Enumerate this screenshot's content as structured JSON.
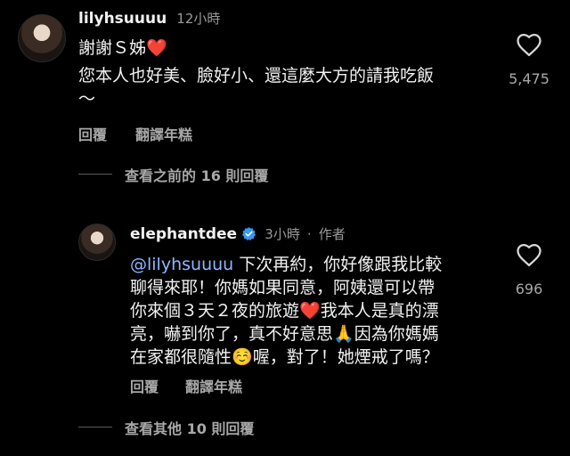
{
  "comment": {
    "username": "lilyhsuuuu",
    "time": "12小時",
    "line1": "謝謝Ｓ姊",
    "line1_emoji": "❤️",
    "line2": "您本人也好美、臉好小、還這麼大方的請我吃飯",
    "line3": "～",
    "likes": "5,475",
    "reply_label": "回覆",
    "translate_label": "翻譯年糕"
  },
  "view_previous": "查看之前的 16 則回覆",
  "reply": {
    "username": "elephantdee",
    "time": "3小時",
    "separator": "·",
    "author_label": "作者",
    "mention": "@lilyhsuuuu",
    "lines": [
      " 下次再約，你好像跟我比較",
      "聊得來耶！你媽如果同意，阿姨還可以帶",
      "你來個３天２夜的旅遊",
      "我本人是真的漂",
      "亮，嚇到你了，真不好意思",
      "因為你媽媽",
      "在家都很隨性",
      "喔，對了！她煙戒了嗎？"
    ],
    "emojis": [
      "❤️",
      "🙏",
      "☺️"
    ],
    "likes": "696",
    "reply_label": "回覆",
    "translate_label": "翻譯年糕"
  },
  "view_other": "查看其他 10 則回覆",
  "colors": {
    "background": "#000000",
    "text": "#f2f2f2",
    "muted": "#a8a8a8",
    "heart_red": "#e0245e",
    "verified_blue": "#3897f0"
  },
  "icons": [
    "heart-outline-icon",
    "verified-badge-icon"
  ]
}
